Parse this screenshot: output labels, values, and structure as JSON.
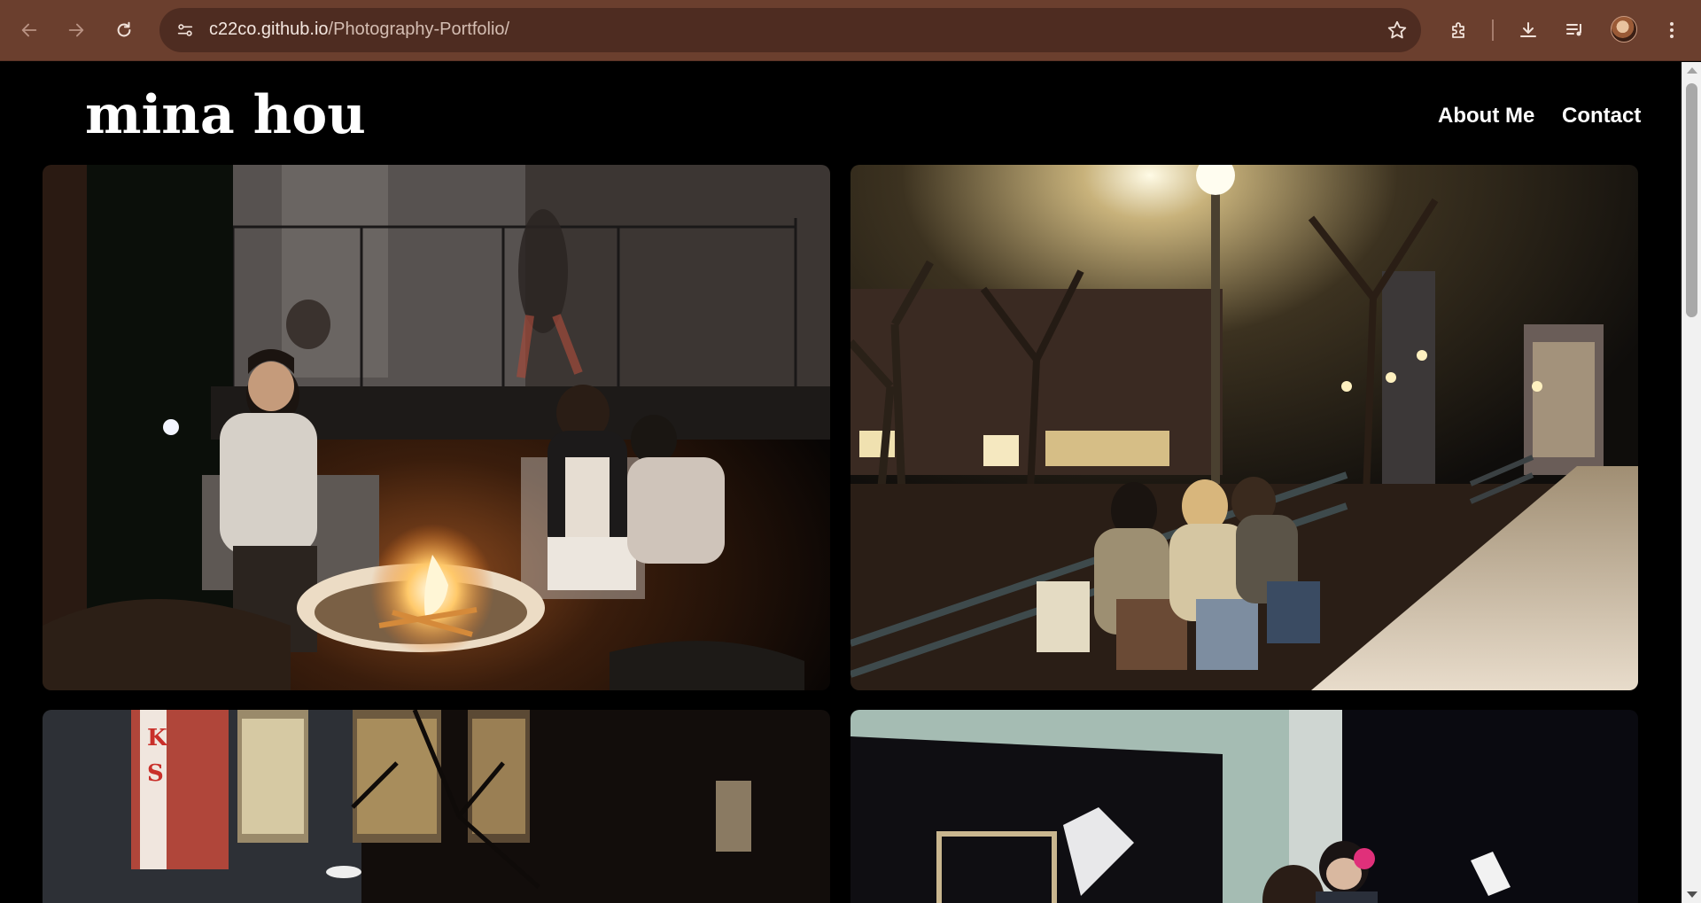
{
  "browser": {
    "url_host": "c22co.github.io",
    "url_path": "/Photography-Portfolio/",
    "icons": [
      "back-arrow-icon",
      "forward-arrow-icon",
      "reload-icon",
      "site-info-icon",
      "bookmark-star-icon",
      "extensions-icon",
      "download-icon",
      "media-controls-icon",
      "profile-avatar",
      "kebab-menu-icon"
    ]
  },
  "site": {
    "logo": "mina hou",
    "nav": [
      {
        "label": "About Me"
      },
      {
        "label": "Contact"
      }
    ]
  },
  "gallery": {
    "photos": [
      {
        "subject": "night-bonfire-friends"
      },
      {
        "subject": "night-park-bench-streetlight"
      },
      {
        "subject": "bookstore-window-tree"
      },
      {
        "subject": "gallery-studio-people"
      }
    ]
  },
  "colors": {
    "chrome": "#6b3f2e",
    "omnibox": "#4e2c21",
    "page_bg": "#000000",
    "text": "#ffffff"
  }
}
